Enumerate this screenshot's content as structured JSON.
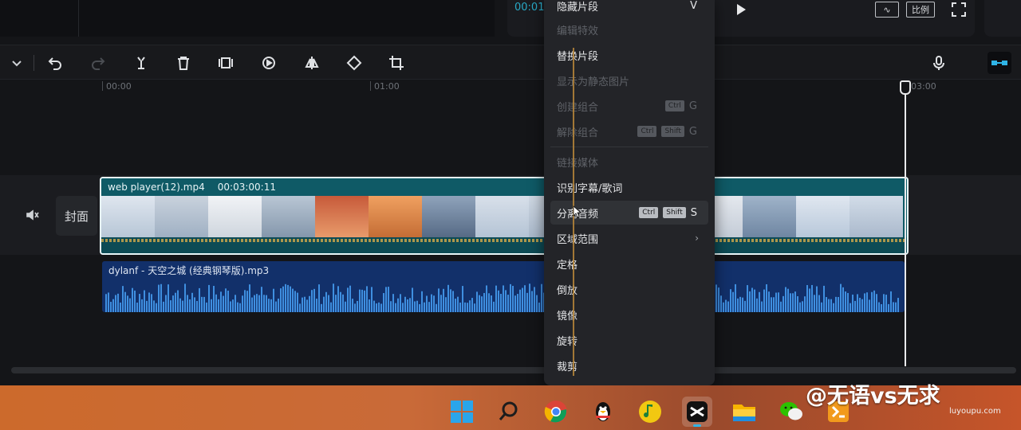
{
  "preview": {
    "timecode": "00:01",
    "wave_btn_label": "∿",
    "ratio_btn_label": "比例"
  },
  "ruler": {
    "labels": [
      "00:00",
      "01:00",
      "03:00"
    ]
  },
  "track": {
    "cover_label": "封面"
  },
  "video_clip": {
    "filename": "web player(12).mp4",
    "duration": "00:03:00:11"
  },
  "audio_clip": {
    "title": "dylanf - 天空之城 (经典钢琴版).mp3"
  },
  "context_menu": {
    "items": [
      {
        "label": "隐藏片段",
        "shortcut_key": "V",
        "disabled": false
      },
      {
        "label": "编辑特效",
        "disabled": true
      },
      {
        "label": "替换片段",
        "disabled": false
      },
      {
        "label": "显示为静态图片",
        "disabled": true
      },
      {
        "label": "创建组合",
        "shortcut_mods": [
          "Ctrl"
        ],
        "shortcut_key": "G",
        "disabled": true
      },
      {
        "label": "解除组合",
        "shortcut_mods": [
          "Ctrl",
          "Shift"
        ],
        "shortcut_key": "G",
        "disabled": true
      },
      {
        "label": "链接媒体",
        "disabled": true
      },
      {
        "label": "识别字幕/歌词",
        "disabled": false
      },
      {
        "label": "分离音频",
        "shortcut_mods": [
          "Ctrl",
          "Shift"
        ],
        "shortcut_key": "S",
        "disabled": false
      },
      {
        "label": "区域范围",
        "disabled": false
      },
      {
        "label": "定格",
        "disabled": false
      },
      {
        "label": "倒放",
        "disabled": false
      },
      {
        "label": "镜像",
        "disabled": false
      },
      {
        "label": "旋转",
        "disabled": false
      },
      {
        "label": "裁剪",
        "disabled": false
      }
    ]
  },
  "colors": {
    "video_clip": "#0f5a66",
    "audio_clip": "#12306a",
    "accent": "#2fb4e6",
    "taskbar": "#c96a38"
  },
  "watermark": {
    "text": "@无语vs无求",
    "domain": "luyoupu.com"
  }
}
